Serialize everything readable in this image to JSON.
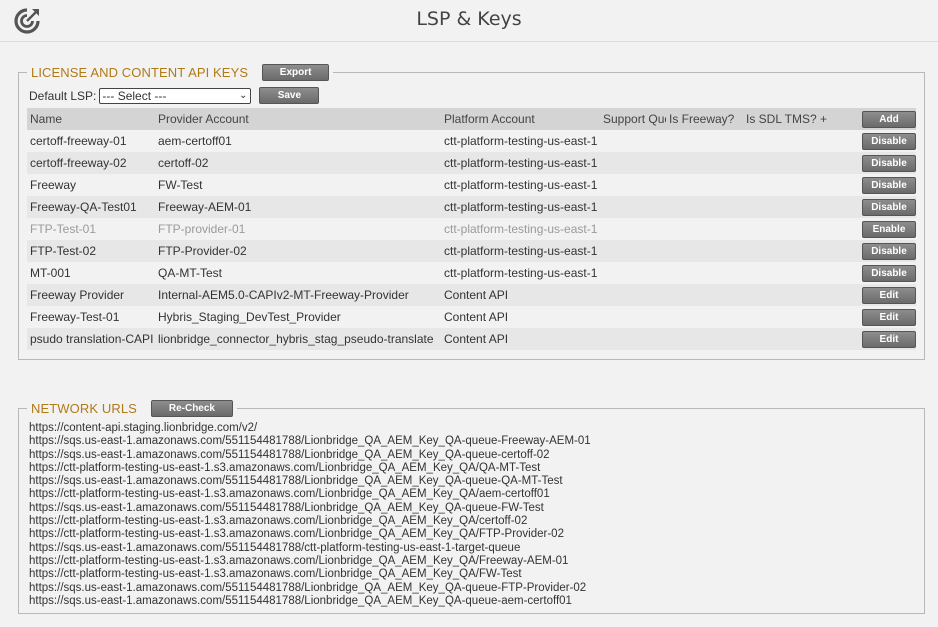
{
  "header": {
    "title": "LSP & Keys"
  },
  "license_section": {
    "legend": "LICENSE AND CONTENT API KEYS",
    "export_label": "Export",
    "default_lsp_label": "Default LSP:",
    "default_lsp_value": "--- Select ---",
    "save_label": "Save",
    "columns": {
      "name": "Name",
      "provider": "Provider Account",
      "platform": "Platform Account",
      "support_quote": "Support Quote",
      "is_freeway": "Is Freeway?",
      "is_sdl": "Is SDL TMS?",
      "plus": "+",
      "add": "Add"
    },
    "rows": [
      {
        "name": "certoff-freeway-01",
        "provider": "aem-certoff01",
        "platform": "ctt-platform-testing-us-east-1",
        "action": "Disable"
      },
      {
        "name": "certoff-freeway-02",
        "provider": "certoff-02",
        "platform": "ctt-platform-testing-us-east-1",
        "action": "Disable"
      },
      {
        "name": "Freeway",
        "provider": "FW-Test",
        "platform": "ctt-platform-testing-us-east-1",
        "action": "Disable"
      },
      {
        "name": "Freeway-QA-Test01",
        "provider": "Freeway-AEM-01",
        "platform": "ctt-platform-testing-us-east-1",
        "action": "Disable"
      },
      {
        "name": "FTP-Test-01",
        "provider": "FTP-provider-01",
        "platform": "ctt-platform-testing-us-east-1",
        "action": "Enable"
      },
      {
        "name": "FTP-Test-02",
        "provider": "FTP-Provider-02",
        "platform": "ctt-platform-testing-us-east-1",
        "action": "Disable"
      },
      {
        "name": "MT-001",
        "provider": "QA-MT-Test",
        "platform": "ctt-platform-testing-us-east-1",
        "action": "Disable"
      },
      {
        "name": "Freeway Provider",
        "provider": "Internal-AEM5.0-CAPIv2-MT-Freeway-Provider",
        "platform": "Content API",
        "action": "Edit"
      },
      {
        "name": "Freeway-Test-01",
        "provider": "Hybris_Staging_DevTest_Provider",
        "platform": "Content API",
        "action": "Edit"
      },
      {
        "name": "psudo translation-CAPI",
        "provider": "lionbridge_connector_hybris_stag_pseudo-translate",
        "platform": "Content API",
        "action": "Edit"
      }
    ]
  },
  "network_section": {
    "legend": "NETWORK URLS",
    "recheck_label": "Re-Check",
    "urls": [
      "https://content-api.staging.lionbridge.com/v2/",
      "https://sqs.us-east-1.amazonaws.com/551154481788/Lionbridge_QA_AEM_Key_QA-queue-Freeway-AEM-01",
      "https://sqs.us-east-1.amazonaws.com/551154481788/Lionbridge_QA_AEM_Key_QA-queue-certoff-02",
      "https://ctt-platform-testing-us-east-1.s3.amazonaws.com/Lionbridge_QA_AEM_Key_QA/QA-MT-Test",
      "https://sqs.us-east-1.amazonaws.com/551154481788/Lionbridge_QA_AEM_Key_QA-queue-QA-MT-Test",
      "https://ctt-platform-testing-us-east-1.s3.amazonaws.com/Lionbridge_QA_AEM_Key_QA/aem-certoff01",
      "https://sqs.us-east-1.amazonaws.com/551154481788/Lionbridge_QA_AEM_Key_QA-queue-FW-Test",
      "https://ctt-platform-testing-us-east-1.s3.amazonaws.com/Lionbridge_QA_AEM_Key_QA/certoff-02",
      "https://ctt-platform-testing-us-east-1.s3.amazonaws.com/Lionbridge_QA_AEM_Key_QA/FTP-Provider-02",
      "https://sqs.us-east-1.amazonaws.com/551154481788/ctt-platform-testing-us-east-1-target-queue",
      "https://ctt-platform-testing-us-east-1.s3.amazonaws.com/Lionbridge_QA_AEM_Key_QA/Freeway-AEM-01",
      "https://ctt-platform-testing-us-east-1.s3.amazonaws.com/Lionbridge_QA_AEM_Key_QA/FW-Test",
      "https://sqs.us-east-1.amazonaws.com/551154481788/Lionbridge_QA_AEM_Key_QA-queue-FTP-Provider-02",
      "https://sqs.us-east-1.amazonaws.com/551154481788/Lionbridge_QA_AEM_Key_QA-queue-aem-certoff01"
    ]
  },
  "colors": {
    "legend": "#b07a18",
    "header_row": "#d4d4d4",
    "alt_row": "#e7e7e7",
    "button": "#777777",
    "disabled_text": "#9a9a9a"
  },
  "icons": {
    "logo": "refresh-target-icon",
    "select_arrow": "chevron-down-icon"
  }
}
